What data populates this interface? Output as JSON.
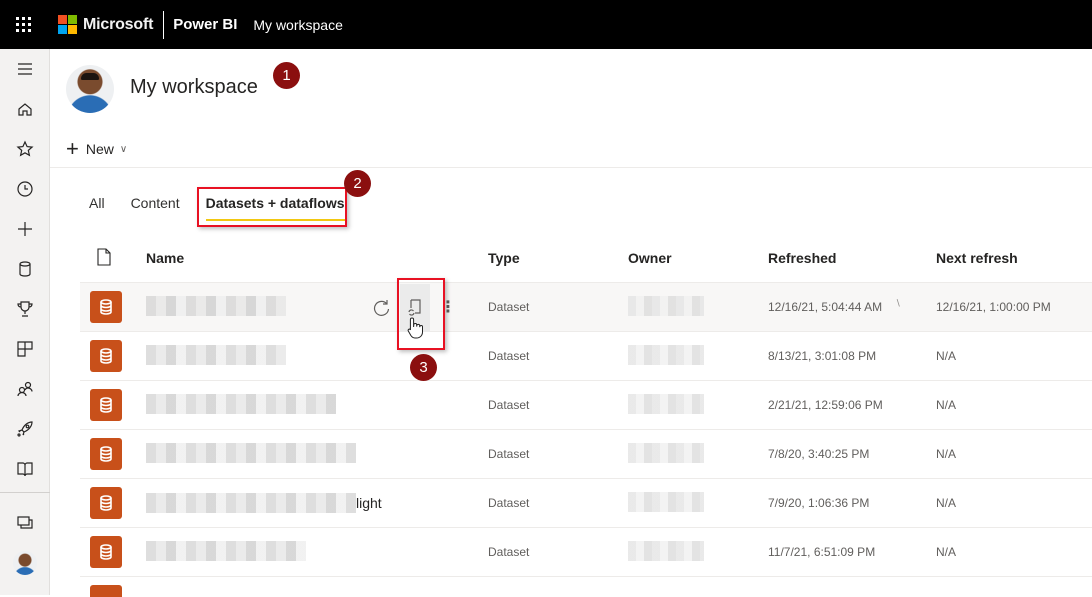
{
  "topbar": {
    "brand": "Microsoft",
    "product": "Power BI",
    "breadcrumb": "My workspace",
    "logo_colors": [
      "#f25022",
      "#7fba00",
      "#00a4ef",
      "#ffb900"
    ]
  },
  "rail": {
    "items": [
      {
        "icon": "hamburger-icon",
        "label": "Navigation menu"
      },
      {
        "icon": "home-icon",
        "label": "Home"
      },
      {
        "icon": "star-icon",
        "label": "Favorites"
      },
      {
        "icon": "clock-icon",
        "label": "Recent"
      },
      {
        "icon": "plus-icon",
        "label": "Create"
      },
      {
        "icon": "datasets-icon",
        "label": "Datasets"
      },
      {
        "icon": "trophy-icon",
        "label": "Goals"
      },
      {
        "icon": "apps-icon",
        "label": "Apps"
      },
      {
        "icon": "shared-icon",
        "label": "Shared with me"
      },
      {
        "icon": "rocket-icon",
        "label": "Deployment pipelines"
      },
      {
        "icon": "learn-icon",
        "label": "Learn"
      },
      {
        "icon": "workspaces-icon",
        "label": "Workspaces"
      },
      {
        "icon": "avatar-icon",
        "label": "My workspace"
      }
    ]
  },
  "workspace": {
    "title": "My workspace",
    "new_label": "New"
  },
  "tabs": [
    {
      "label": "All",
      "active": false
    },
    {
      "label": "Content",
      "active": false
    },
    {
      "label": "Datasets + dataflows",
      "active": true
    }
  ],
  "table": {
    "headers": {
      "name": "Name",
      "type": "Type",
      "owner": "Owner",
      "refreshed": "Refreshed",
      "next_refresh": "Next refresh"
    },
    "rows": [
      {
        "name": "",
        "type": "Dataset",
        "refreshed": "12/16/21, 5:04:44 AM",
        "next_refresh": "12/16/21, 1:00:00 PM"
      },
      {
        "name": "",
        "type": "Dataset",
        "refreshed": "8/13/21, 3:01:08 PM",
        "next_refresh": "N/A"
      },
      {
        "name": "",
        "type": "Dataset",
        "refreshed": "2/21/21, 12:59:06 PM",
        "next_refresh": "N/A"
      },
      {
        "name": "",
        "type": "Dataset",
        "refreshed": "7/8/20, 3:40:25 PM",
        "next_refresh": "N/A"
      },
      {
        "name": "light",
        "type": "Dataset",
        "refreshed": "7/9/20, 1:06:36 PM",
        "next_refresh": "N/A"
      },
      {
        "name": "",
        "type": "Dataset",
        "refreshed": "11/7/21, 6:51:09 PM",
        "next_refresh": "N/A"
      }
    ]
  },
  "annotations": [
    {
      "number": "1"
    },
    {
      "number": "2"
    },
    {
      "number": "3"
    }
  ],
  "colors": {
    "accent_tab": "#f2c811",
    "dataset_icon": "#c8501a",
    "callout": "#8b0f0f",
    "highlight_box": "#e81123"
  }
}
